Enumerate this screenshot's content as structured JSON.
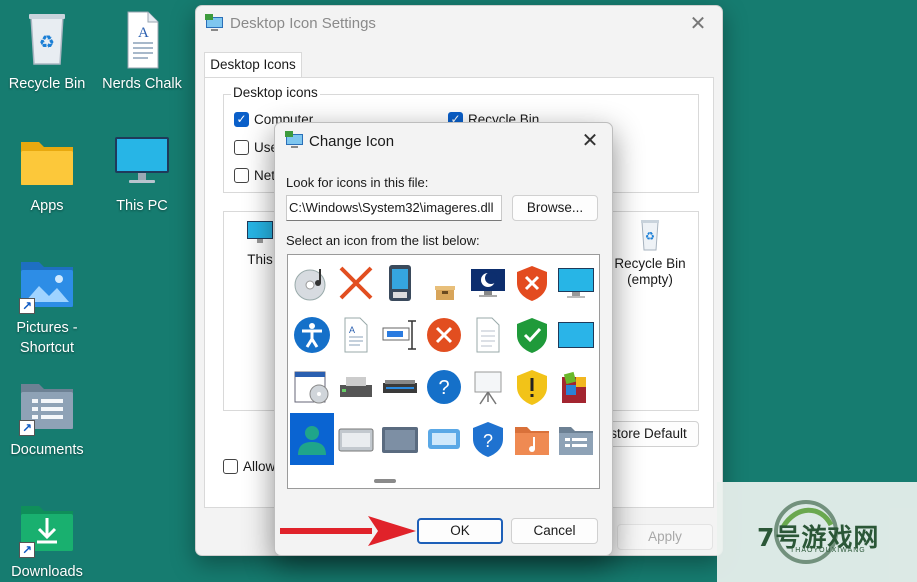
{
  "desktop": {
    "icons": [
      {
        "label": "Recycle Bin",
        "icon": "recycle-bin-icon"
      },
      {
        "label": "Nerds Chalk",
        "icon": "document-icon"
      },
      {
        "label": "Apps",
        "icon": "folder-icon"
      },
      {
        "label": "This PC",
        "icon": "monitor-icon"
      },
      {
        "label": "Pictures -\nShortcut",
        "icon": "pictures-folder-icon"
      },
      {
        "label": "Documents",
        "icon": "documents-folder-icon"
      },
      {
        "label": "Downloads",
        "icon": "downloads-folder-icon"
      }
    ]
  },
  "desktop_icon_settings": {
    "title": "Desktop Icon Settings",
    "tab": "Desktop Icons",
    "group_label": "Desktop icons",
    "checkboxes": [
      {
        "label": "Computer",
        "checked": true
      },
      {
        "label": "Recycle Bin",
        "checked": true
      },
      {
        "label": "Use",
        "checked": false
      },
      {
        "label": "Net",
        "checked": false
      }
    ],
    "preview_items": [
      {
        "label": "This",
        "icon": "monitor-icon"
      },
      {
        "label": "Recycle Bin\n(empty)",
        "icon": "recycle-bin-empty-icon"
      }
    ],
    "restore_default_label": "store Default",
    "allow_label": "Allow",
    "apply_label": "Apply"
  },
  "change_icon": {
    "title": "Change Icon",
    "look_for_label": "Look for icons in this file:",
    "path_value": "C:\\Windows\\System32\\imageres.dll",
    "browse_label": "Browse...",
    "select_label": "Select an icon from the list below:",
    "icons": [
      "cd-music-icon",
      "red-x-icon",
      "portable-device-icon",
      "box-icon",
      "night-display-icon",
      "shield-x-icon",
      "monitor-icon",
      "accessibility-icon",
      "document-text-icon",
      "text-cursor-icon",
      "error-circle-icon",
      "blank-document-icon",
      "shield-check-icon",
      "display-blue-icon",
      "window-cd-icon",
      "scanner-printer-icon",
      "scanner-icon",
      "help-circle-icon",
      "projector-screen-icon",
      "shield-warning-icon",
      "windows-apps-icon",
      "user-account-icon",
      "drive-tray-icon",
      "storage-drive-icon",
      "card-device-icon",
      "shield-help-icon",
      "music-folder-icon",
      "contacts-folder-icon"
    ],
    "selected_index": 21,
    "ok_label": "OK",
    "cancel_label": "Cancel"
  },
  "watermark": {
    "text": "7号游戏网",
    "subtext": "THAOYOUXIWANG"
  },
  "colors": {
    "desktop": "#167c70",
    "accent": "#0a5fc9",
    "arrow": "#e0222a"
  }
}
